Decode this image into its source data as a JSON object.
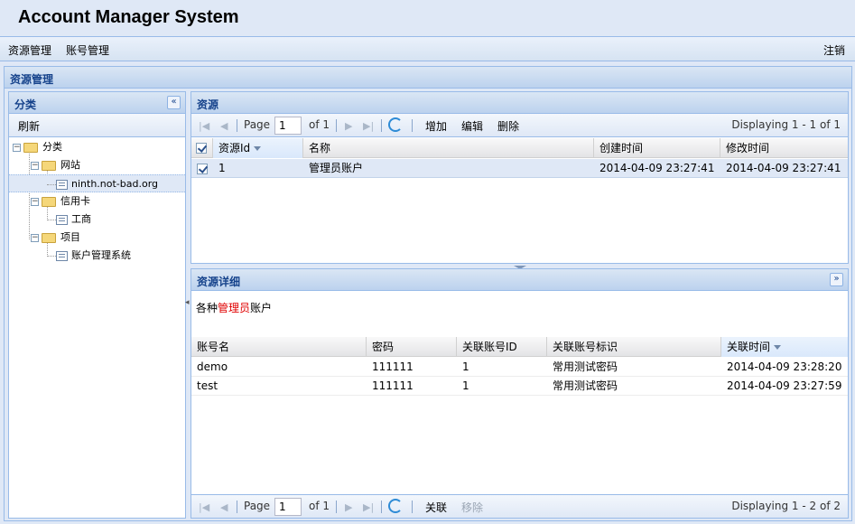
{
  "app": {
    "title": "Account Manager System"
  },
  "menu": {
    "items": [
      "资源管理",
      "账号管理"
    ],
    "logout": "注销"
  },
  "main_panel": {
    "title": "资源管理"
  },
  "category_panel": {
    "title": "分类",
    "refresh": "刷新",
    "tree": [
      {
        "label": "分类",
        "level": 0,
        "type": "folder"
      },
      {
        "label": "网站",
        "level": 1,
        "type": "folder"
      },
      {
        "label": "ninth.not-bad.org",
        "level": 2,
        "type": "leaf",
        "selected": true
      },
      {
        "label": "信用卡",
        "level": 1,
        "type": "folder"
      },
      {
        "label": "工商",
        "level": 2,
        "type": "leaf"
      },
      {
        "label": "项目",
        "level": 1,
        "type": "folder"
      },
      {
        "label": "账户管理系统",
        "level": 2,
        "type": "leaf"
      }
    ]
  },
  "resource_panel": {
    "title": "资源",
    "paging": {
      "page_label": "Page",
      "page_value": "1",
      "of_label": "of 1",
      "display": "Displaying 1 - 1 of 1"
    },
    "actions": {
      "add": "增加",
      "edit": "编辑",
      "delete": "删除"
    },
    "columns": [
      "资源Id",
      "名称",
      "创建时间",
      "修改时间"
    ],
    "rows": [
      {
        "id": "1",
        "name": "管理员账户",
        "created": "2014-04-09 23:27:41",
        "modified": "2014-04-09 23:27:41",
        "checked": true
      }
    ]
  },
  "detail_panel": {
    "title": "资源详细",
    "description": {
      "prefix": "各种",
      "highlight": "管理员",
      "suffix": "账户"
    },
    "columns": [
      "账号名",
      "密码",
      "关联账号ID",
      "关联账号标识",
      "关联时间"
    ],
    "rows": [
      {
        "account": "demo",
        "password": "111111",
        "link_id": "1",
        "link_tag": "常用测试密码",
        "link_time": "2014-04-09 23:28:20"
      },
      {
        "account": "test",
        "password": "111111",
        "link_id": "1",
        "link_tag": "常用测试密码",
        "link_time": "2014-04-09 23:27:59"
      }
    ],
    "paging": {
      "page_label": "Page",
      "page_value": "1",
      "of_label": "of 1",
      "display": "Displaying 1 - 2 of 2"
    },
    "actions": {
      "link": "关联",
      "remove": "移除"
    }
  }
}
